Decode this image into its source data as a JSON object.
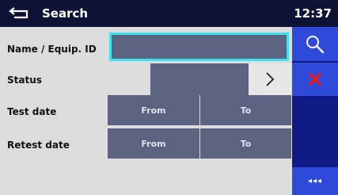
{
  "header": {
    "title": "Search",
    "time": "12:37"
  },
  "form": {
    "name_label": "Name / Equip. ID",
    "name_value": "",
    "status_label": "Status",
    "status_value": "",
    "test_date_label": "Test date",
    "retest_date_label": "Retest date",
    "from_label": "From",
    "to_label": "To"
  },
  "sidebar": {
    "more_label": "◂◂◂",
    "search_icon": "search-icon",
    "cancel_icon": "close-icon"
  },
  "colors": {
    "header_bg": "#0e1234",
    "field_bg": "#5b6380",
    "field_focus": "#3fe0ef",
    "sidebar_bg": "#101a86",
    "sidebar_button": "#2f49d9",
    "cancel_red": "#e41b1b"
  }
}
